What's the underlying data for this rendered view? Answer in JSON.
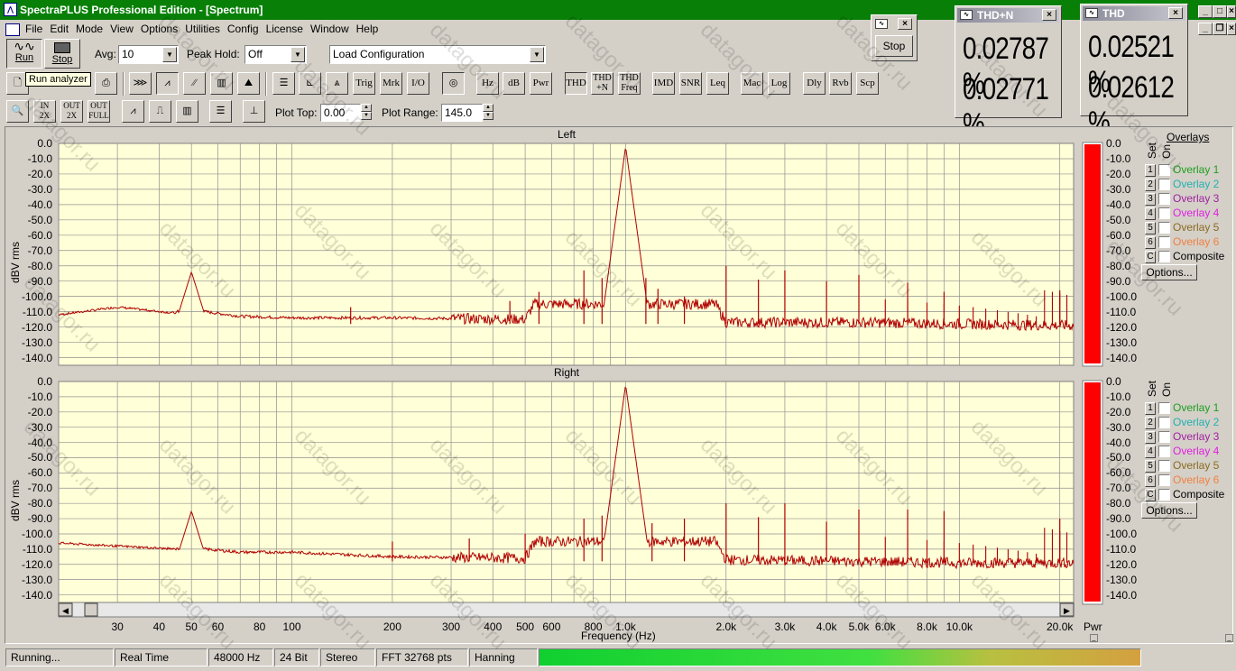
{
  "window": {
    "title": "SpectraPLUS Professional Edition - [Spectrum]"
  },
  "menu": [
    "File",
    "Edit",
    "Mode",
    "View",
    "Options",
    "Utilities",
    "Config",
    "License",
    "Window",
    "Help"
  ],
  "toolbar1": {
    "run_label": "Run",
    "stop_label": "Stop",
    "avg_label": "Avg:",
    "avg_value": "10",
    "peakhold_label": "Peak Hold:",
    "peakhold_value": "Off",
    "config_value": "Load Configuration",
    "tooltip": "Run analyzer"
  },
  "toolbar2": {
    "trig": "Trig",
    "mrk": "Mrk",
    "io": "I/O",
    "hz": "Hz",
    "db": "dB",
    "pwr": "Pwr",
    "thd": "THD",
    "thdn": "THD +N",
    "thdfreq": "THD Freq",
    "imd": "IMD",
    "snr": "SNR",
    "leq": "Leq",
    "mac": "Mac",
    "log": "Log",
    "dly": "Dly",
    "rvb": "Rvb",
    "scp": "Scp"
  },
  "toolbar3": {
    "plot_top_label": "Plot Top:",
    "plot_top_value": "0.00",
    "plot_range_label": "Plot Range:",
    "plot_range_value": "145.0",
    "zin": "2X",
    "zout": "2X",
    "zfull": "FULL"
  },
  "stop_window": {
    "button": "Stop"
  },
  "thdn_meter": {
    "title": "THD+N",
    "value1": "0.02787 %",
    "value2": "0.02771 %"
  },
  "thd_meter": {
    "title": "THD",
    "value1": "0.02521 %",
    "value2": "0.02612 %"
  },
  "plots": {
    "left_title": "Left",
    "right_title": "Right",
    "ylabel": "dBV rms",
    "xlabel": "Frequency (Hz)",
    "y_ticks": [
      "0.0",
      "-10.0",
      "-20.0",
      "-30.0",
      "-40.0",
      "-50.0",
      "-60.0",
      "-70.0",
      "-80.0",
      "-90.0",
      "-100.0",
      "-110.0",
      "-120.0",
      "-130.0",
      "-140.0"
    ],
    "x_ticks": [
      "30",
      "40",
      "50",
      "60",
      "80",
      "100",
      "200",
      "300",
      "400",
      "500",
      "600",
      "800",
      "1.0k",
      "2.0k",
      "3.0k",
      "4.0k",
      "5.0k",
      "6.0k",
      "8.0k",
      "10.0k",
      "20.0k"
    ],
    "pwr_label": "Pwr"
  },
  "overlays": {
    "title": "Overlays",
    "set_label": "Set",
    "on_label": "On",
    "items": [
      {
        "num": "1",
        "label": "Overlay 1",
        "color": "#1e9e1e"
      },
      {
        "num": "2",
        "label": "Overlay 2",
        "color": "#20b0b0"
      },
      {
        "num": "3",
        "label": "Overlay 3",
        "color": "#a020a0"
      },
      {
        "num": "4",
        "label": "Overlay 4",
        "color": "#e020e0"
      },
      {
        "num": "5",
        "label": "Overlay 5",
        "color": "#8a6a20"
      },
      {
        "num": "6",
        "label": "Overlay 6",
        "color": "#f08040"
      }
    ],
    "composite_num": "C",
    "composite_label": "Composite",
    "options_label": "Options..."
  },
  "status": {
    "state": "Running...",
    "mode": "Real Time",
    "rate": "48000 Hz",
    "bits": "24 Bit",
    "channels": "Stereo",
    "fft": "FFT 32768 pts",
    "window": "Hanning"
  },
  "watermark": "datagor.ru",
  "colors": {
    "title_bar": "#088008",
    "plot_bg": "#ffffd8",
    "trace": "#b00000",
    "level_bar": "#ff0000"
  },
  "chart_data": [
    {
      "type": "line",
      "title": "Left",
      "xlabel": "Frequency (Hz)",
      "ylabel": "dBV rms",
      "xscale": "log",
      "xlim": [
        20,
        22000
      ],
      "ylim": [
        -145,
        0
      ],
      "series": [
        {
          "x": [
            20,
            30,
            45,
            50,
            55,
            70,
            100,
            200,
            500,
            1000,
            2000,
            5000,
            10000,
            20000
          ],
          "y": [
            -112,
            -107,
            -111,
            -84,
            -110,
            -113,
            -114,
            -114,
            -115,
            -2,
            -117,
            -117,
            -118,
            -119
          ]
        }
      ],
      "peaks": [
        [
          150,
          -107
        ],
        [
          450,
          -103
        ],
        [
          550,
          -97
        ],
        [
          750,
          -83
        ],
        [
          850,
          -88
        ],
        [
          1000,
          -2
        ],
        [
          1150,
          -88
        ],
        [
          1250,
          -95
        ],
        [
          1500,
          -100
        ],
        [
          2000,
          -80
        ],
        [
          2500,
          -89
        ],
        [
          3000,
          -83
        ],
        [
          4000,
          -90
        ],
        [
          5000,
          -86
        ],
        [
          7000,
          -91
        ],
        [
          9000,
          -97
        ],
        [
          20000,
          -96
        ]
      ]
    },
    {
      "type": "line",
      "title": "Right",
      "xlabel": "Frequency (Hz)",
      "ylabel": "dBV rms",
      "xscale": "log",
      "xlim": [
        20,
        22000
      ],
      "ylim": [
        -145,
        0
      ],
      "series": [
        {
          "x": [
            20,
            30,
            45,
            50,
            55,
            70,
            100,
            200,
            500,
            1000,
            2000,
            5000,
            10000,
            20000
          ],
          "y": [
            -106,
            -108,
            -110,
            -85,
            -110,
            -112,
            -112,
            -115,
            -116,
            -2,
            -117,
            -118,
            -119,
            -119
          ]
        }
      ],
      "peaks": [
        [
          200,
          -105
        ],
        [
          340,
          -103
        ],
        [
          500,
          -100
        ],
        [
          750,
          -90
        ],
        [
          850,
          -88
        ],
        [
          1000,
          -2
        ],
        [
          1200,
          -93
        ],
        [
          1500,
          -90
        ],
        [
          2000,
          -80
        ],
        [
          2500,
          -89
        ],
        [
          3000,
          -80
        ],
        [
          4000,
          -92
        ],
        [
          5000,
          -84
        ],
        [
          7000,
          -84
        ],
        [
          9000,
          -85
        ],
        [
          20000,
          -90
        ]
      ]
    }
  ]
}
